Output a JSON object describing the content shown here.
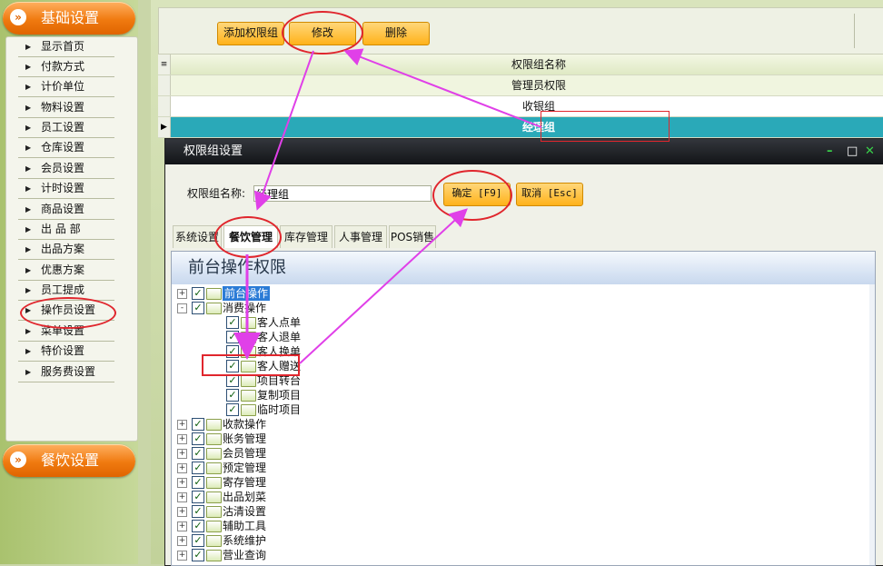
{
  "sidebar": {
    "header1": "基础设置",
    "header2": "餐饮设置",
    "items": [
      "显示首页",
      "付款方式",
      "计价单位",
      "物料设置",
      "员工设置",
      "仓库设置",
      "会员设置",
      "计时设置",
      "商品设置",
      "出 品 部",
      "出品方案",
      "优惠方案",
      "员工提成",
      "操作员设置",
      "菜单设置",
      "特价设置",
      "服务费设置"
    ]
  },
  "toolbar": {
    "add_label": "添加权限组",
    "edit_label": "修改",
    "delete_label": "删除"
  },
  "grid": {
    "header": "权限组名称",
    "rows": [
      "管理员权限",
      "收银组",
      "经理组"
    ]
  },
  "dialog": {
    "title": "权限组设置",
    "name_label": "权限组名称:",
    "name_value": "经理组",
    "ok_label": "确定 [F9]",
    "cancel_label": "取消 [Esc]",
    "tabs": [
      "系统设置",
      "餐饮管理",
      "库存管理",
      "人事管理",
      "POS销售"
    ],
    "panel_title": "前台操作权限",
    "tree": [
      {
        "label": "前台操作",
        "level": 0,
        "expander": "+"
      },
      {
        "label": "消费操作",
        "level": 0,
        "expander": "-"
      },
      {
        "label": "客人点单",
        "level": 1
      },
      {
        "label": "客人退单",
        "level": 1
      },
      {
        "label": "客人换单",
        "level": 1
      },
      {
        "label": "客人赠送",
        "level": 1
      },
      {
        "label": "项目转台",
        "level": 1
      },
      {
        "label": "复制项目",
        "level": 1
      },
      {
        "label": "临时项目",
        "level": 1
      },
      {
        "label": "收款操作",
        "level": 0,
        "expander": "+"
      },
      {
        "label": "账务管理",
        "level": 0,
        "expander": "+"
      },
      {
        "label": "会员管理",
        "level": 0,
        "expander": "+"
      },
      {
        "label": "预定管理",
        "level": 0,
        "expander": "+"
      },
      {
        "label": "寄存管理",
        "level": 0,
        "expander": "+"
      },
      {
        "label": "出品划菜",
        "level": 0,
        "expander": "+"
      },
      {
        "label": "沽清设置",
        "level": 0,
        "expander": "+"
      },
      {
        "label": "辅助工具",
        "level": 0,
        "expander": "+"
      },
      {
        "label": "系统维护",
        "level": 0,
        "expander": "+"
      },
      {
        "label": "营业查询",
        "level": 0,
        "expander": "+"
      }
    ]
  },
  "icons": {
    "window_min": "–",
    "window_max": "□",
    "window_close": "✕"
  },
  "colors": {
    "accent_orange": "#f07a10",
    "selected_row": "#2aa9b8",
    "annotation_red": "#e0262d",
    "arrow_magenta": "#e040e8"
  }
}
